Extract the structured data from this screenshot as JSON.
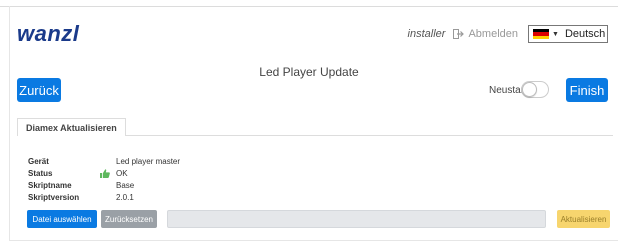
{
  "header": {
    "logo": "wanzl",
    "user": "installer",
    "logout_label": "Abmelden",
    "language": {
      "selected": "Deutsch",
      "flag": "de"
    }
  },
  "page": {
    "title": "Led Player Update",
    "back_label": "Zurück",
    "finish_label": "Finish",
    "restart_label": "Neustart",
    "restart_enabled": false
  },
  "tabs": [
    {
      "label": "Diamex Aktualisieren",
      "active": true
    }
  ],
  "device_info": [
    {
      "label": "Gerät",
      "value": "Led player master",
      "icon": ""
    },
    {
      "label": "Status",
      "value": "OK",
      "icon": "thumbs-up-icon"
    },
    {
      "label": "Skriptname",
      "value": "Base",
      "icon": ""
    },
    {
      "label": "Skriptversion",
      "value": "2.0.1",
      "icon": ""
    }
  ],
  "actions": {
    "choose_file_label": "Datei auswählen",
    "reset_label": "Zurücksetzen",
    "update_label": "Aktualisieren",
    "upload_progress": 0
  },
  "colors": {
    "primary": "#0a7ae2",
    "secondary": "#9aa0a6",
    "warning": "#f7d56e",
    "logo": "#1a3a8a",
    "ok_icon": "#5cb85c"
  }
}
